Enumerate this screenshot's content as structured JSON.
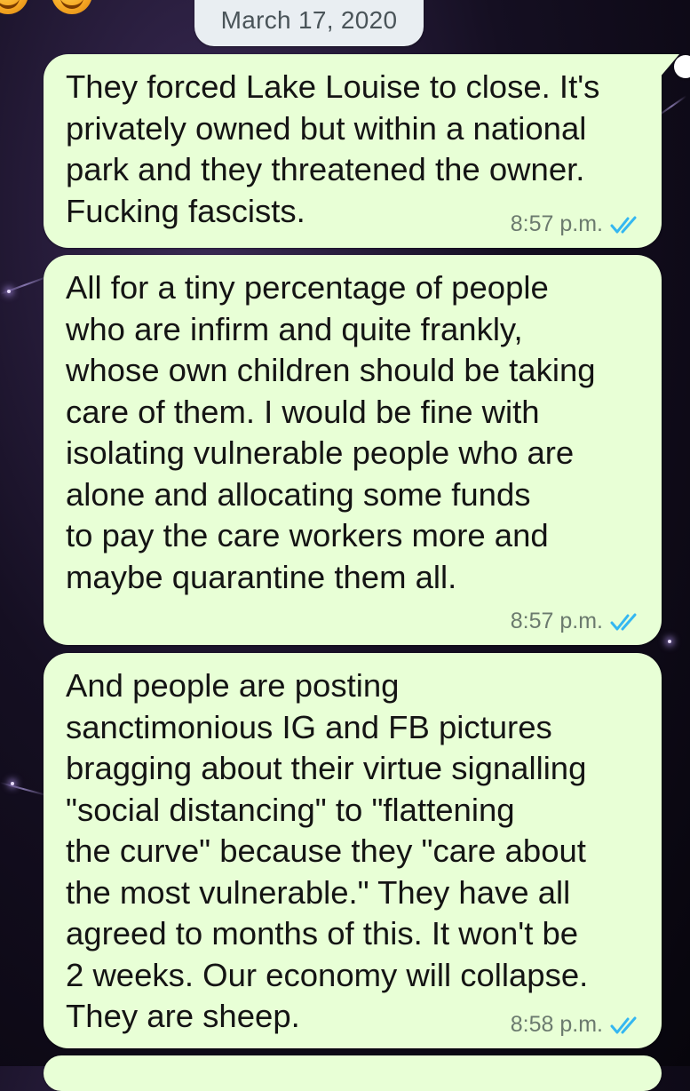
{
  "chat": {
    "date": "March 17, 2020",
    "messages": [
      {
        "text": "They forced Lake Louise to close. It's\nprivately owned but within a national\npark and they threatened the owner.\nFucking fascists.",
        "time": "8:57 p.m.",
        "status": "read",
        "tick_color": "#34b7f1"
      },
      {
        "text": "All for a tiny percentage of people\nwho are infirm and quite frankly,\nwhose own children should be taking\ncare of them. I would be fine with\nisolating vulnerable people who are\nalone and allocating some funds\nto pay the care workers more and\nmaybe quarantine them all.",
        "time": "8:57 p.m.",
        "status": "read",
        "tick_color": "#34b7f1"
      },
      {
        "text": "And people are posting\nsanctimonious IG and FB pictures\nbragging about their virtue signalling\n\"social distancing\" to \"flattening\nthe curve\" because they \"care about\nthe most vulnerable.\" They have all\nagreed to months of this. It won't be\n2 weeks. Our economy will collapse.\nThey are sheep.",
        "time": "8:58 p.m.",
        "status": "read",
        "tick_color": "#34b7f1"
      }
    ]
  },
  "colors": {
    "outgoing_bubble": "#e8ffd6",
    "date_chip": "#e9eef2",
    "read_tick": "#34b7f1"
  }
}
